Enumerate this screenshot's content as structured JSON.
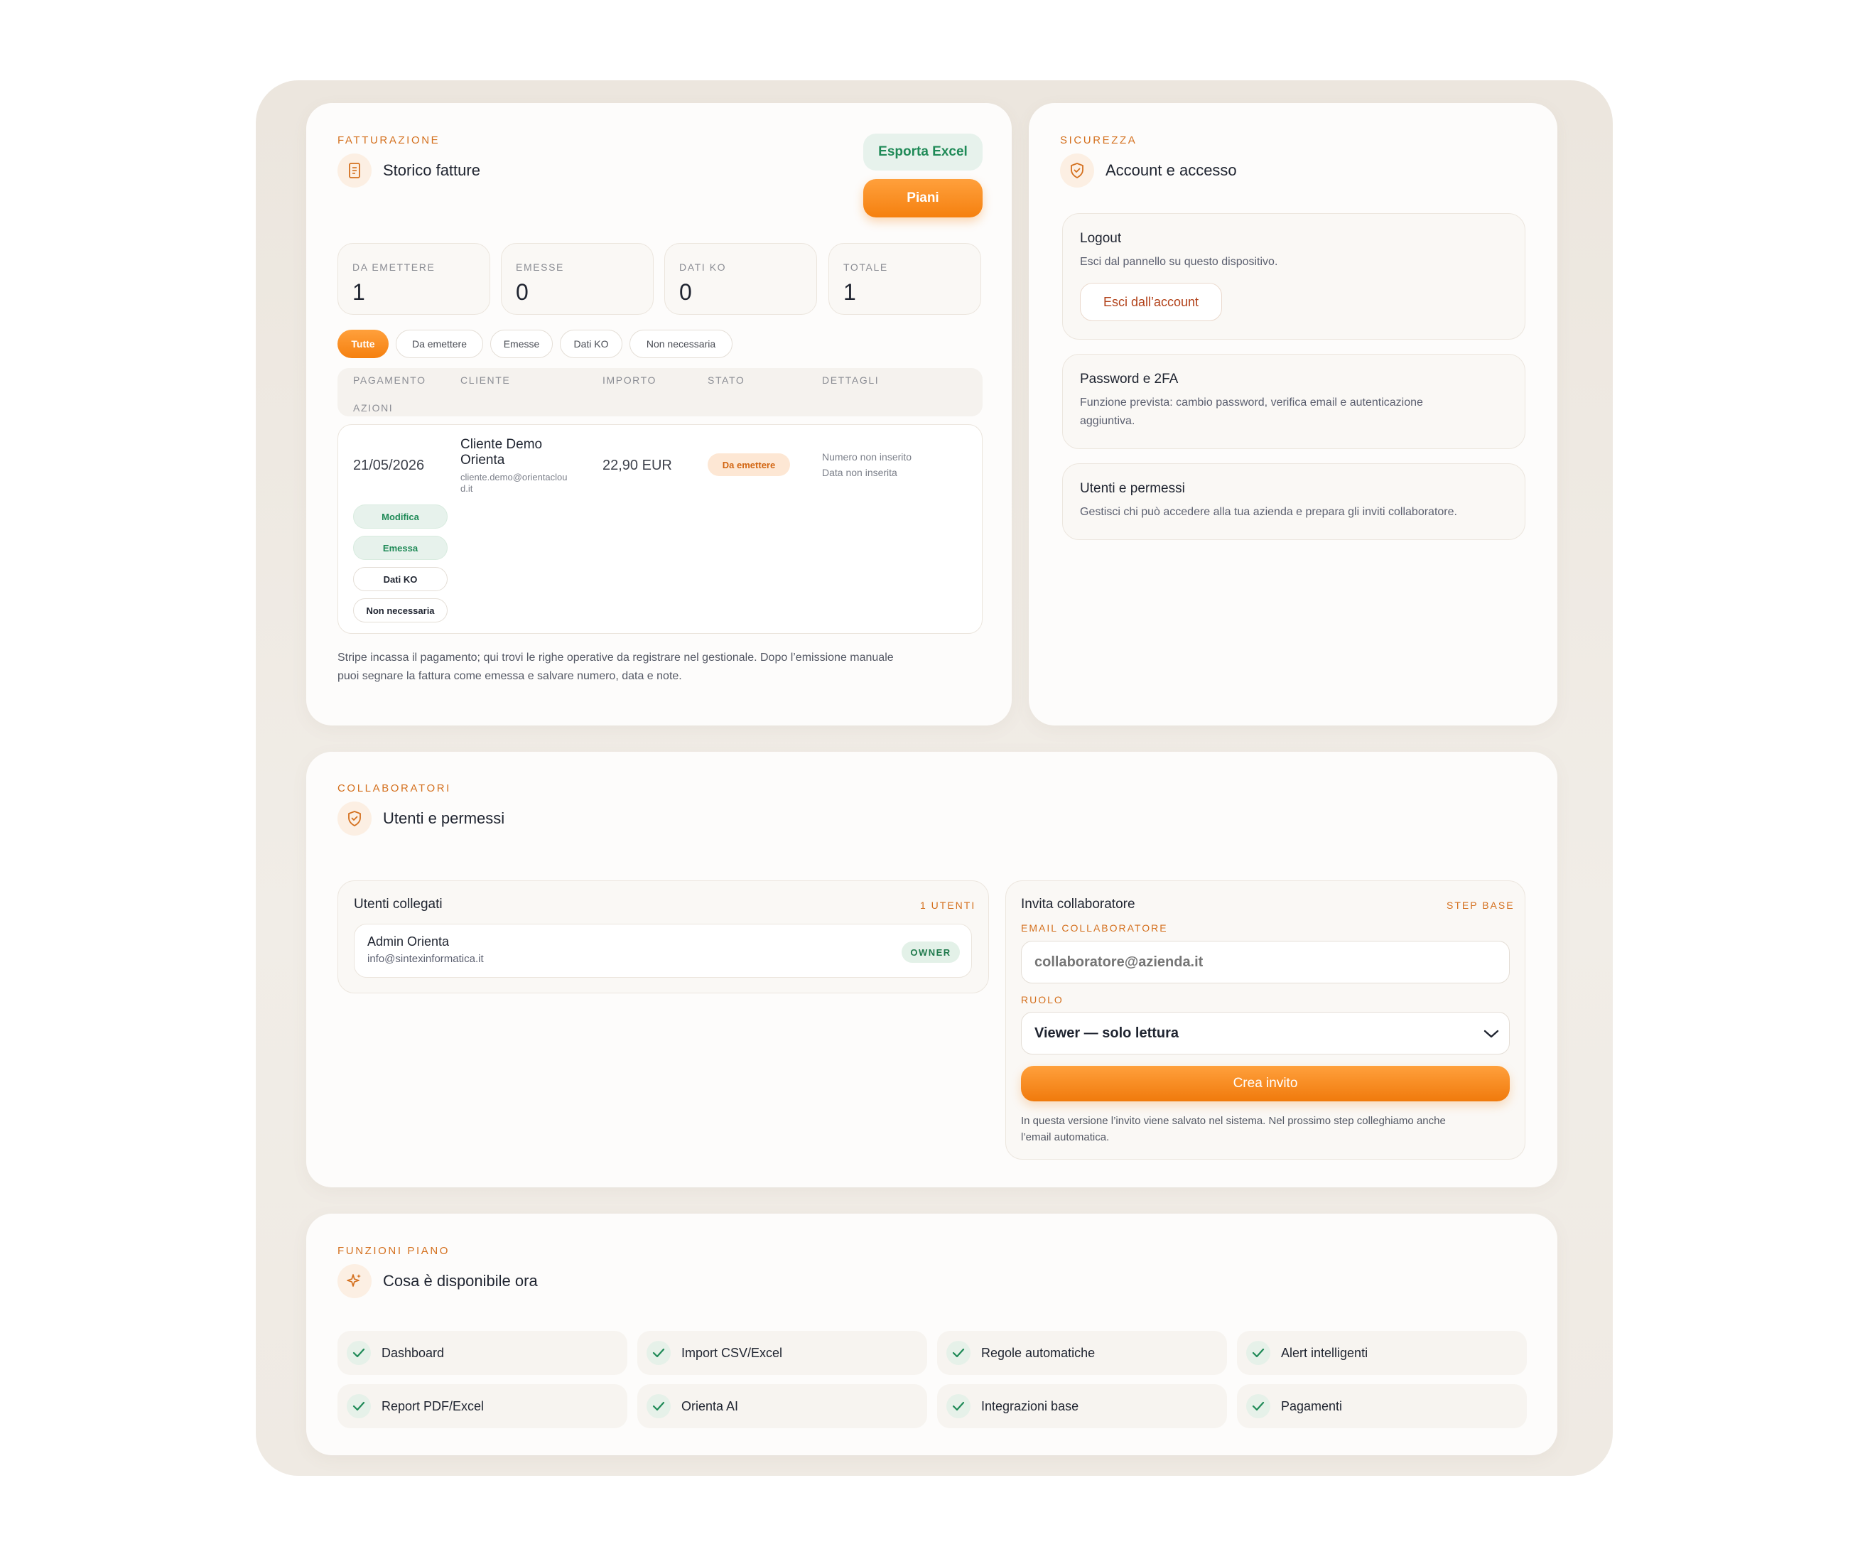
{
  "billing": {
    "eyebrow": "FATTURAZIONE",
    "title": "Storico fatture",
    "export_label": "Esporta Excel",
    "plans_label": "Piani",
    "stats": [
      {
        "label": "DA EMETTERE",
        "value": "1"
      },
      {
        "label": "EMESSE",
        "value": "0"
      },
      {
        "label": "DATI KO",
        "value": "0"
      },
      {
        "label": "TOTALE",
        "value": "1"
      }
    ],
    "filters": [
      "Tutte",
      "Da emettere",
      "Emesse",
      "Dati KO",
      "Non necessaria"
    ],
    "columns": [
      "PAGAMENTO",
      "CLIENTE",
      "IMPORTO",
      "STATO",
      "DETTAGLI",
      "AZIONI"
    ],
    "row": {
      "date": "21/05/2026",
      "client_name_1": "Cliente Demo",
      "client_name_2": "Orienta",
      "client_email_1": "cliente.demo@orientaclou",
      "client_email_2": "d.it",
      "amount": "22,90 EUR",
      "status": "Da emettere",
      "detail_1": "Numero non inserito",
      "detail_2": "Data non inserita",
      "actions": [
        "Modifica",
        "Emessa",
        "Dati KO",
        "Non necessaria"
      ]
    },
    "note_1": "Stripe incassa il pagamento; qui trovi le righe operative da registrare nel gestionale. Dopo l’emissione manuale",
    "note_2": "puoi segnare la fattura come emessa e salvare numero, data e note."
  },
  "security": {
    "eyebrow": "SICUREZZA",
    "title": "Account e accesso",
    "logout_title": "Logout",
    "logout_desc": "Esci dal pannello su questo dispositivo.",
    "logout_button": "Esci dall’account",
    "password_title": "Password e 2FA",
    "password_desc_1": "Funzione prevista: cambio password, verifica email e autenticazione",
    "password_desc_2": "aggiuntiva.",
    "users_title": "Utenti e permessi",
    "users_desc": "Gestisci chi può accedere alla tua azienda e prepara gli inviti collaboratore."
  },
  "collaborators": {
    "eyebrow": "COLLABORATORI",
    "title": "Utenti e permessi",
    "linked_title": "Utenti collegati",
    "linked_count": "1 UTENTI",
    "user_name": "Admin Orienta",
    "user_email": "info@sintexinformatica.it",
    "user_role": "OWNER",
    "invite_title": "Invita collaboratore",
    "invite_step": "STEP BASE",
    "email_label": "EMAIL COLLABORATORE",
    "email_placeholder": "collaboratore@azienda.it",
    "role_label": "RUOLO",
    "role_value": "Viewer — solo lettura",
    "create_label": "Crea invito",
    "invite_note_1": "In questa versione l’invito viene salvato nel sistema. Nel prossimo step colleghiamo anche",
    "invite_note_2": "l’email automatica."
  },
  "features": {
    "eyebrow": "FUNZIONI PIANO",
    "title": "Cosa è disponibile ora",
    "items": [
      "Dashboard",
      "Import CSV/Excel",
      "Regole automatiche",
      "Alert intelligenti",
      "Report PDF/Excel",
      "Orienta AI",
      "Integrazioni base",
      "Pagamenti"
    ]
  },
  "colors": {
    "accent": "#f5800f",
    "success": "#1f8a57",
    "eyebrow": "#d4701e"
  }
}
